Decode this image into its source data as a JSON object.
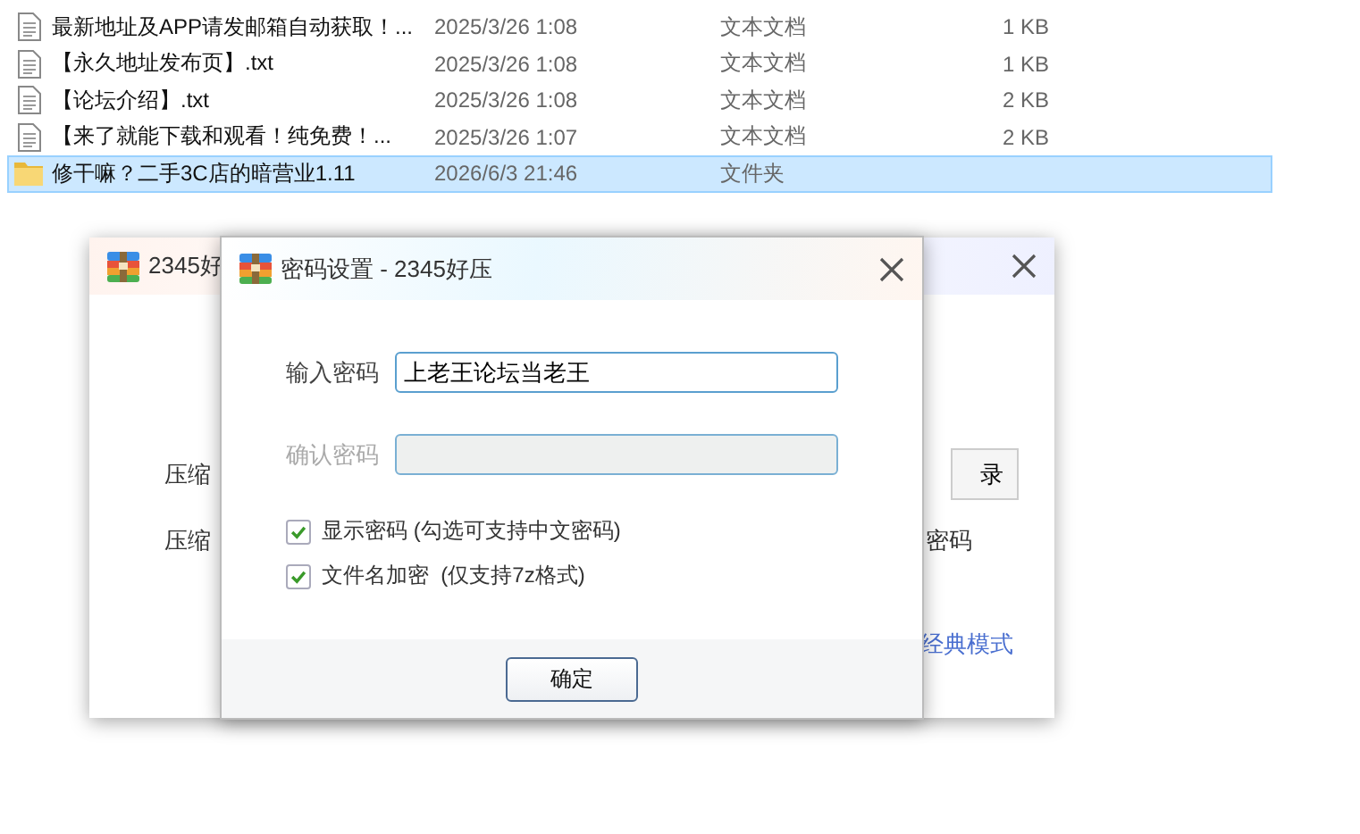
{
  "file_list": {
    "rows": [
      {
        "kind": "document",
        "name": "最新地址及APP请发邮箱自动获取！...",
        "modified": "2025/3/26 1:08",
        "type": "文本文档",
        "size": "1 KB",
        "selected": false
      },
      {
        "kind": "document",
        "name": "【永久地址发布页】.txt",
        "modified": "2025/3/26 1:08",
        "type": "文本文档",
        "size": "1 KB",
        "selected": false
      },
      {
        "kind": "document",
        "name": "【论坛介绍】.txt",
        "modified": "2025/3/26 1:08",
        "type": "文本文档",
        "size": "2 KB",
        "selected": false
      },
      {
        "kind": "document",
        "name": "【来了就能下载和观看！纯免费！...",
        "modified": "2025/3/26 1:07",
        "type": "文本文档",
        "size": "2 KB",
        "selected": false
      },
      {
        "kind": "folder",
        "name": "修干嘛？二手3C店的暗营业1.11",
        "modified": "2026/6/3 21:46",
        "type": "文件夹",
        "selected": true
      }
    ]
  },
  "back_window": {
    "title": "2345好",
    "rows": [
      {
        "label": "压缩",
        "button": "录"
      },
      {
        "label": "压缩",
        "trailing": "密码"
      }
    ],
    "link": "经典模式"
  },
  "password_dialog": {
    "title": "密码设置 - 2345好压",
    "fields": [
      {
        "label": "输入密码",
        "value": "上老王论坛当老王",
        "disabled": false
      },
      {
        "label": "确认密码",
        "disabled": true
      }
    ],
    "options": [
      {
        "label": "显示密码 (勾选可支持中文密码)",
        "checked": true
      },
      {
        "label": "文件名加密  (仅支持7z格式)",
        "checked": true
      }
    ],
    "button": "确定"
  }
}
